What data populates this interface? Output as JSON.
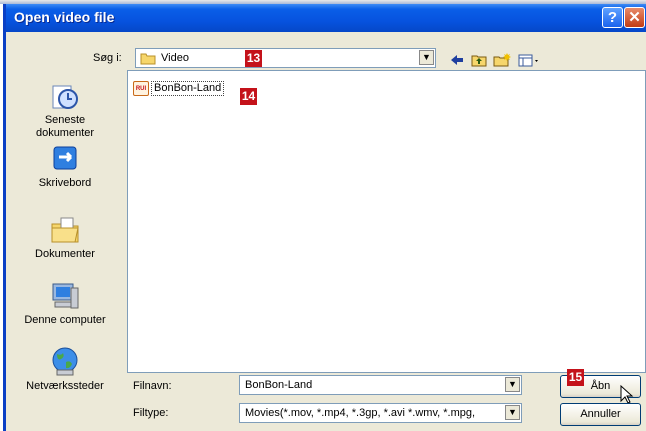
{
  "window": {
    "title": "Open video file",
    "help_glyph": "?",
    "close_glyph": "✕"
  },
  "lookin": {
    "label": "Søg i:",
    "value": "Video",
    "badge": "13"
  },
  "toolbar": {
    "icons": [
      "back-arrow-icon",
      "up-folder-icon",
      "new-folder-icon",
      "view-menu-icon"
    ]
  },
  "places": [
    {
      "label": "Seneste\ndokumenter",
      "icon": "recent-documents-icon"
    },
    {
      "label": "Skrivebord",
      "icon": "desktop-icon"
    },
    {
      "label": "Dokumenter",
      "icon": "my-documents-icon"
    },
    {
      "label": "Denne computer",
      "icon": "my-computer-icon"
    },
    {
      "label": "Netværkssteder",
      "icon": "network-places-icon"
    }
  ],
  "files": [
    {
      "name": "BonBon-Land",
      "badge": "14",
      "icon": "video-file-icon",
      "icon_text": "RUI"
    }
  ],
  "filename": {
    "label": "Filnavn:",
    "value": "BonBon-Land"
  },
  "filetype": {
    "label": "Filtype:",
    "value": "Movies(*.mov, *.mp4, *.3gp, *.avi *.wmv, *.mpg,"
  },
  "buttons": {
    "open": "Åbn",
    "open_badge": "15",
    "cancel": "Annuller"
  },
  "colors": {
    "titlebar": "#0753df",
    "badge": "#c4121a",
    "dialog_bg": "#ece9d8"
  }
}
